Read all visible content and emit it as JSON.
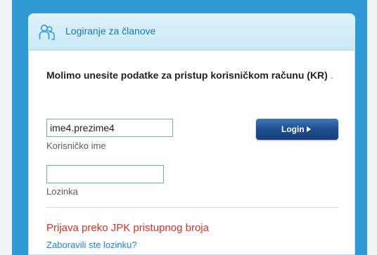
{
  "header": {
    "title": "Logiranje za članove",
    "icon": "user-icon"
  },
  "intro": {
    "text": "Molimo unesite podatke za pristup korisničkom računu (KR)",
    "trailing_dot": "."
  },
  "login_form": {
    "username_value": "ime4.prezime4",
    "username_label": "Korisničko ime",
    "password_value": "",
    "password_label": "Lozinka",
    "login_button_label": "Login",
    "login_button_icon": "arrow-right-icon"
  },
  "links": {
    "pin_login": "Prijava preko JPK pristupnog broja",
    "forgot_password": "Zaboravili ste lozinku?"
  },
  "colors": {
    "frame_blue": "#2f99d3",
    "header_text": "#1678b8",
    "button_blue": "#1f4f8e",
    "link_red": "#d13226",
    "link_blue": "#1f84c7"
  }
}
